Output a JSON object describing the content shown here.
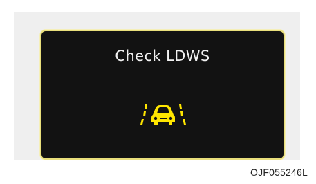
{
  "display": {
    "message": "Check LDWS",
    "icon": "lane-departure-warning-icon",
    "icon_color": "#ffe600"
  },
  "figure": {
    "code": "OJF055246L"
  }
}
